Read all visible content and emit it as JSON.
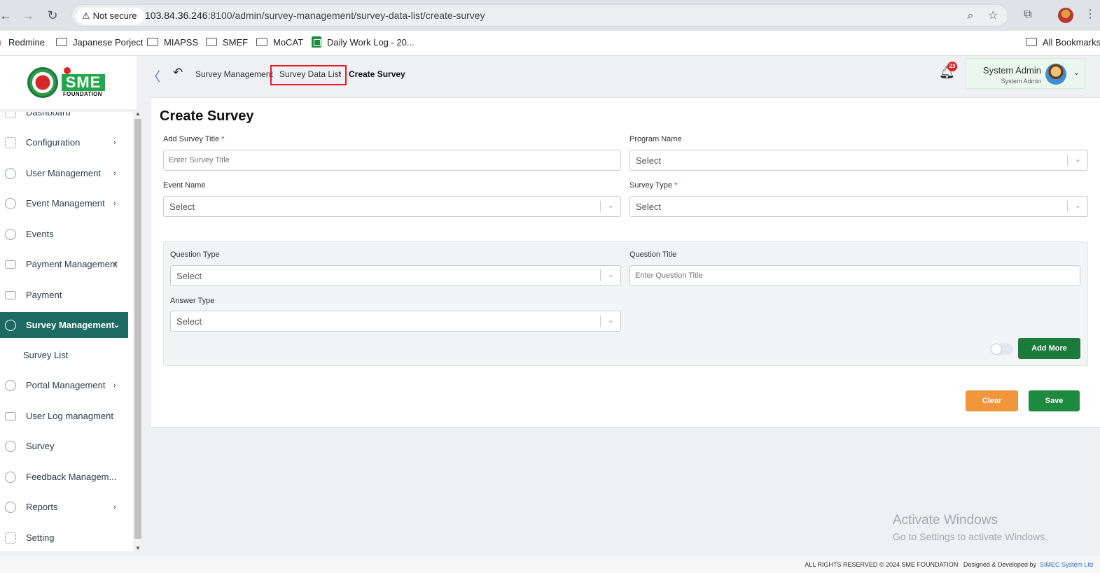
{
  "browser": {
    "security_label": "Not secure",
    "url_host": "103.84.36.246",
    "url_rest": ":8100/admin/survey-management/survey-data-list/create-survey",
    "bookmarks": [
      "Redmine",
      "Japanese Porject",
      "MIAPSS",
      "SMEF",
      "MoCAT",
      "Daily Work Log - 20...",
      "All Bookmarks"
    ]
  },
  "logo": {
    "text": "SME",
    "subtitle": "FOUNDATION"
  },
  "breadcrumb": {
    "items": [
      "Survey Management",
      "Survey Data List",
      "Create Survey"
    ]
  },
  "header": {
    "notifications_count": "23",
    "user_name": "System Admin",
    "user_role": "System Admin"
  },
  "sidebar": {
    "items": [
      {
        "label": "Dashboard",
        "icon": "dashboard-icon",
        "has_arrow": false
      },
      {
        "label": "Configuration",
        "icon": "configuration-icon",
        "has_arrow": true
      },
      {
        "label": "User Management",
        "icon": "user-management-icon",
        "has_arrow": true
      },
      {
        "label": "Event Management",
        "icon": "event-management-icon",
        "has_arrow": true
      },
      {
        "label": "Events",
        "icon": "events-icon",
        "has_arrow": false
      },
      {
        "label": "Payment Management",
        "icon": "payment-management-icon",
        "has_arrow": true
      },
      {
        "label": "Payment",
        "icon": "payment-icon",
        "has_arrow": false
      },
      {
        "label": "Survey Management",
        "icon": "survey-management-icon",
        "has_arrow": true,
        "active": true
      },
      {
        "label": "Portal Management",
        "icon": "portal-management-icon",
        "has_arrow": true
      },
      {
        "label": "User Log managment",
        "icon": "user-log-icon",
        "has_arrow": false
      },
      {
        "label": "Survey",
        "icon": "survey-icon",
        "has_arrow": false
      },
      {
        "label": "Feedback Managem...",
        "icon": "feedback-icon",
        "has_arrow": false
      },
      {
        "label": "Reports",
        "icon": "reports-icon",
        "has_arrow": true
      },
      {
        "label": "Setting",
        "icon": "setting-icon",
        "has_arrow": false
      }
    ],
    "sub_item": "Survey List"
  },
  "form": {
    "title": "Create Survey",
    "survey_title_label": "Add Survey Title",
    "survey_title_placeholder": "Enter Survey Title",
    "program_name_label": "Program Name",
    "program_name_value": "Select",
    "event_name_label": "Event Name",
    "event_name_value": "Select",
    "survey_type_label": "Survey Type",
    "survey_type_value": "Select",
    "question_type_label": "Question Type",
    "question_type_value": "Select",
    "question_title_label": "Question Title",
    "question_title_placeholder": "Enter Question Title",
    "answer_type_label": "Answer Type",
    "answer_type_value": "Select",
    "required_mark": "*",
    "add_more_label": "Add More",
    "clear_label": "Clear",
    "save_label": "Save"
  },
  "watermark": {
    "line1": "Activate Windows",
    "line2": "Go to Settings to activate Windows."
  },
  "footer": {
    "rights": "ALL RIGHTS RESERVED © 2024 SME FOUNDATION",
    "designed_by": "Designed & Developed by",
    "company": "SIMEC System Ltd"
  },
  "colors": {
    "sidebar_active": "#1b6b63",
    "primary_button": "#1b7a3c",
    "clear_button": "#f0963c",
    "breadcrumb_highlight": "#e21d24"
  }
}
